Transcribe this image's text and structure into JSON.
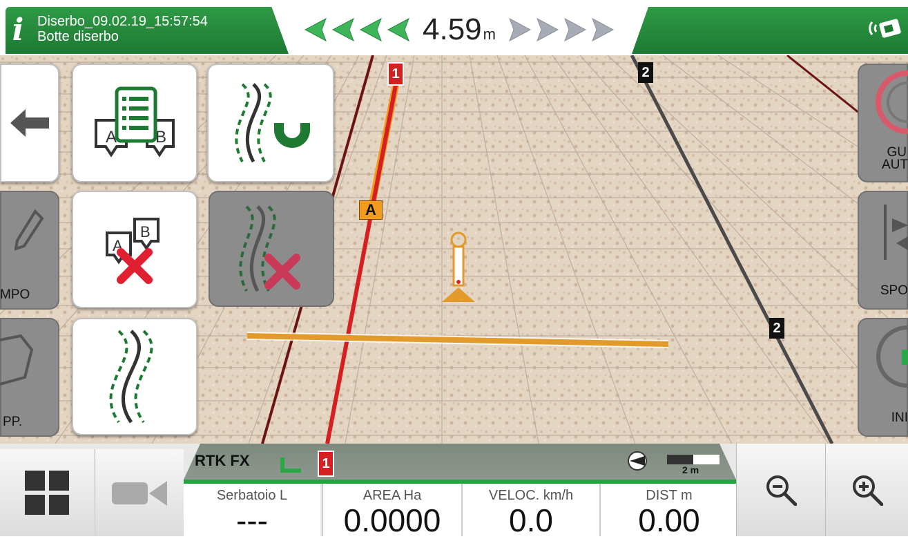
{
  "header": {
    "job_name": "Diserbo_09.02.19_15:57:54",
    "implement": "Botte diserbo",
    "info_icon": "info-icon",
    "offset_value": "4.59",
    "offset_unit": "m",
    "gps_icon": "satellite-signal-icon",
    "left_arrow_color": "#3fb55a",
    "right_arrow_color": "#a6abb6"
  },
  "map": {
    "guidance_line_labels": [
      "1",
      "2",
      "2"
    ],
    "point_a_label": "A",
    "line_1_bottom_label": "1"
  },
  "left_menu": {
    "back_icon": "back-arrow-icon",
    "ab_list_icon": "ab-lines-list-icon",
    "snap_icon": "magnet-snap-line-icon",
    "delete_ab_icon": "delete-ab-points-icon",
    "delete_line_icon": "delete-guidance-line-icon",
    "curve_line_icon": "curved-guidance-line-icon",
    "campo_label": "MPO",
    "app_label": "PP."
  },
  "right_menu": {
    "guida_auto_label_1": "GU",
    "guida_auto_label_2": "AUT",
    "spostamento_label": "SPO",
    "inizio_label": "INI"
  },
  "status": {
    "rtk": "RTK FX",
    "scale": "2 m"
  },
  "bottom": {
    "menu_icon": "grid-menu-icon",
    "camera_icon": "camera-icon",
    "readouts": [
      {
        "label": "Serbatoio L",
        "value": "---"
      },
      {
        "label": "AREA Ha",
        "value": "0.0000"
      },
      {
        "label": "VELOC. km/h",
        "value": "0.0"
      },
      {
        "label": "DIST m",
        "value": "0.00"
      }
    ],
    "zoom_out_icon": "zoom-out-icon",
    "zoom_in_icon": "zoom-in-icon"
  }
}
